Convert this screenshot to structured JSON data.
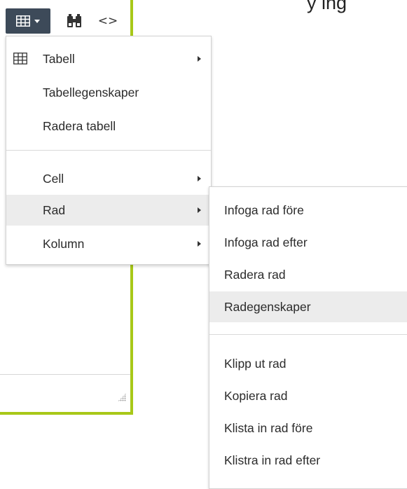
{
  "page": {
    "partial_heading": "y  ing"
  },
  "toolbar": {
    "table_icon": "table-icon",
    "find_icon": "binoculars-icon",
    "source_code_icon": "source-code-icon",
    "source_code_glyph": "<>"
  },
  "colors": {
    "editor_border": "#a8c818",
    "toolbar_active": "#3d4a59",
    "menu_active_bg": "#ececec",
    "menu_border": "#d3d3d3"
  },
  "table_menu": {
    "items": [
      {
        "label": "Tabell",
        "icon": "table-icon",
        "has_submenu": true
      },
      {
        "label": "Tabellegenskaper",
        "has_submenu": false
      },
      {
        "label": "Radera tabell",
        "has_submenu": false
      },
      {
        "label": "Cell",
        "has_submenu": true
      },
      {
        "label": "Rad",
        "has_submenu": true,
        "active": true
      },
      {
        "label": "Kolumn",
        "has_submenu": true
      }
    ]
  },
  "row_submenu": {
    "items": [
      {
        "label": "Infoga rad före"
      },
      {
        "label": "Infoga rad efter"
      },
      {
        "label": "Radera rad"
      },
      {
        "label": "Radegenskaper",
        "active": true
      },
      {
        "label": "Klipp ut rad"
      },
      {
        "label": "Kopiera rad"
      },
      {
        "label": "Klista in rad före"
      },
      {
        "label": "Klistra in rad efter"
      }
    ]
  }
}
